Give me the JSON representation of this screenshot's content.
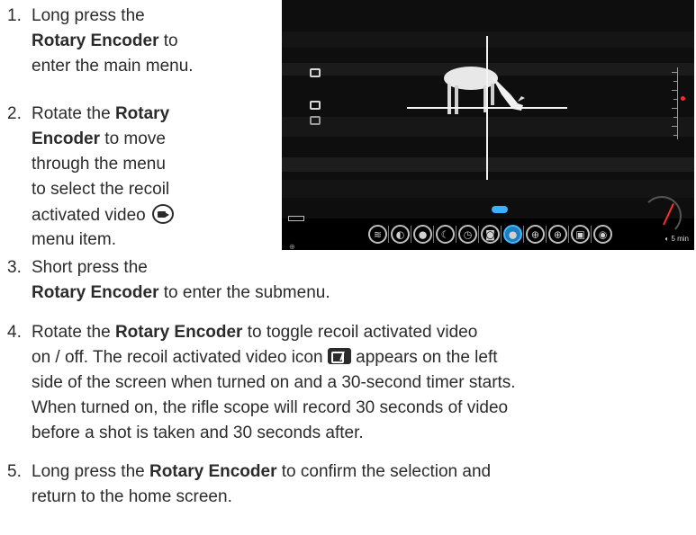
{
  "steps": [
    {
      "number": "1.",
      "lines": [
        [
          "Long press the"
        ],
        [
          "",
          "Rotary Encoder",
          " to"
        ],
        [
          "enter the main menu."
        ]
      ]
    },
    {
      "number": "2.",
      "lines": [
        [
          "Rotate the ",
          "Rotary"
        ],
        [
          "",
          "Encoder",
          " to move"
        ],
        [
          "through the menu"
        ],
        [
          "to select the recoil"
        ],
        [
          "activated video"
        ],
        [
          "menu item."
        ]
      ]
    },
    {
      "number": "3.",
      "lines": [
        [
          "Short press the"
        ],
        [
          "",
          "Rotary Encoder",
          " to enter the submenu."
        ]
      ]
    },
    {
      "number": "4.",
      "lines": [
        [
          "Rotate the ",
          "Rotary Encoder",
          " to toggle recoil activated video"
        ],
        [
          "on / off. The recoil activated video icon"
        ],
        [
          "appears on the left"
        ],
        [
          "side of the screen when turned on and a 30-second timer starts."
        ],
        [
          "When turned on, the rifle scope will record 30 seconds of video"
        ],
        [
          "before a shot is taken and 30 seconds after."
        ]
      ]
    },
    {
      "number": "5.",
      "lines": [
        [
          "Long press the ",
          "Rotary Encoder",
          " to confirm the selection and"
        ],
        [
          "return to the home screen."
        ]
      ]
    }
  ],
  "scope_screen": {
    "timer_label": "5 min",
    "active_menu_index": 5
  }
}
